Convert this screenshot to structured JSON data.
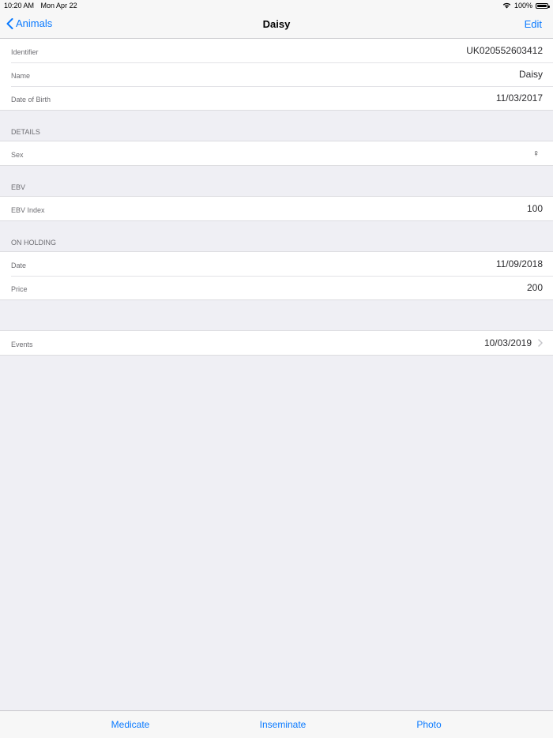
{
  "status_bar": {
    "time": "10:20 AM",
    "date": "Mon Apr 22",
    "battery": "100%",
    "battery_level": 1.0
  },
  "nav": {
    "back_label": "Animals",
    "title": "Daisy",
    "edit_label": "Edit"
  },
  "basic": [
    {
      "label": "Identifier",
      "value": "UK020552603412"
    },
    {
      "label": "Name",
      "value": "Daisy"
    },
    {
      "label": "Date of Birth",
      "value": "11/03/2017"
    }
  ],
  "details": {
    "header": "DETAILS",
    "sex_label": "Sex",
    "sex_value": "♀"
  },
  "ebv": {
    "header": "EBV",
    "index_label": "EBV Index",
    "index_value": "100"
  },
  "on_holding": {
    "header": "ON HOLDING",
    "date_label": "Date",
    "date_value": "11/09/2018",
    "price_label": "Price",
    "price_value": "200"
  },
  "events": {
    "label": "Events",
    "value": "10/03/2019"
  },
  "toolbar": {
    "medicate": "Medicate",
    "inseminate": "Inseminate",
    "photo": "Photo"
  },
  "colors": {
    "accent": "#0a7aff",
    "background": "#efeff4",
    "cell": "#ffffff"
  }
}
